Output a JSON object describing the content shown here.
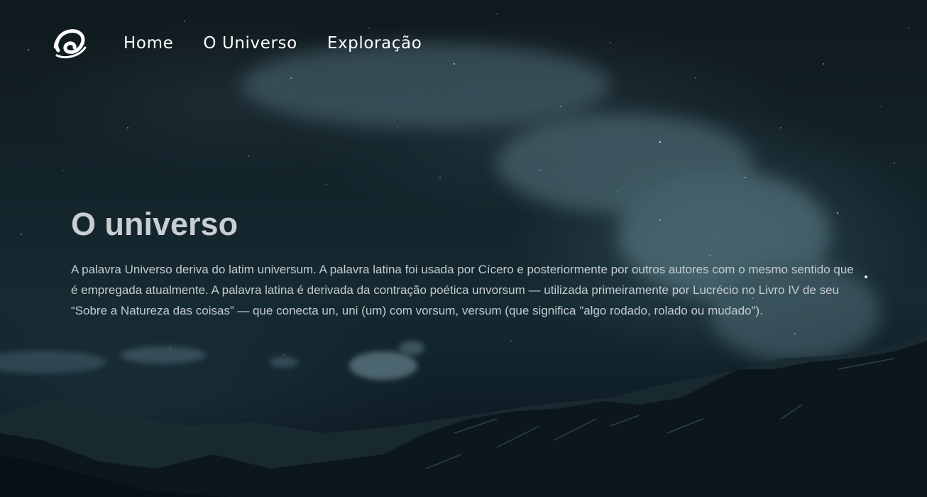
{
  "nav": {
    "logo_icon": "swirl-logo-icon",
    "items": [
      {
        "label": "Home"
      },
      {
        "label": "O Universo"
      },
      {
        "label": "Exploração"
      }
    ]
  },
  "hero": {
    "title": "O universo",
    "paragraph": "A palavra Universo deriva do latim universum. A palavra latina foi usada por Cícero e posteriormente por outros autores com o mesmo sentido que é empregada atualmente. A palavra latina é derivada da contração poética unvorsum — utilizada primeiramente por Lucrécio no Livro IV de seu “Sobre a Natureza das coisas” — que conecta un, uni (um) com vorsum, versum (que significa \"algo rodado, rolado ou mudado\")."
  },
  "background": {
    "sky": "#13232a",
    "mountains": "#0a1418",
    "clouds": "#5f8590"
  }
}
